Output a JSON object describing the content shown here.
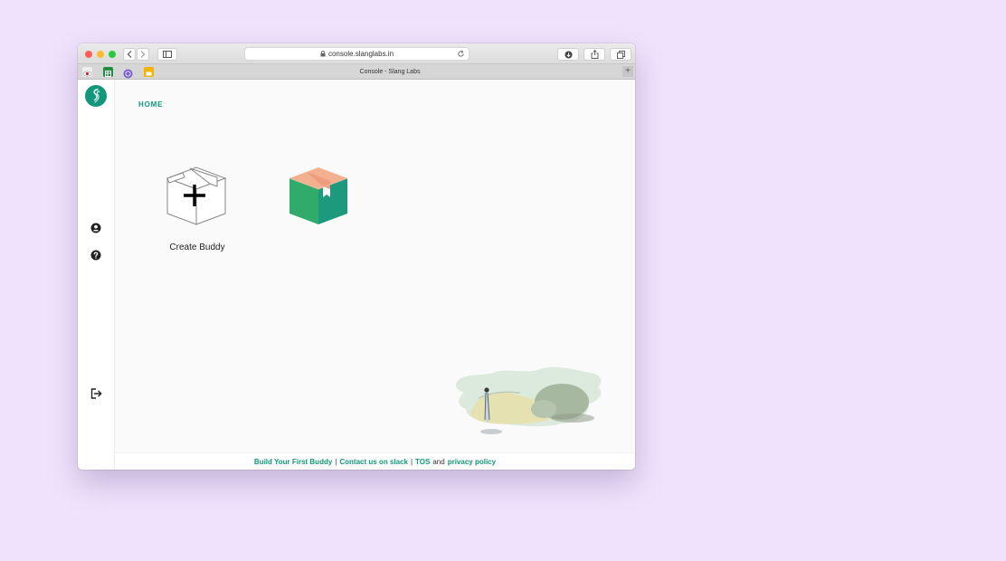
{
  "browser": {
    "url": "console.slanglabs.in",
    "tab_title": "Console - Slang Labs",
    "new_tab_symbol": "+"
  },
  "sidebar": {
    "items": [
      {
        "icon": "account-icon"
      },
      {
        "icon": "help-icon"
      },
      {
        "icon": "logout-icon"
      }
    ]
  },
  "main": {
    "section_title": "HOME",
    "cards": [
      {
        "label": "Create Buddy",
        "icon": "add-box-icon"
      },
      {
        "label": "",
        "icon": "box-icon"
      }
    ]
  },
  "footer": {
    "link_build": "Build Your First Buddy",
    "sep1": "|",
    "link_contact": "Contact us on slack",
    "sep2": "|",
    "link_tos": "TOS",
    "and_text": "and",
    "link_privacy": "privacy policy"
  },
  "colors": {
    "brand": "#11987a",
    "background": "#f0e2fd",
    "box_green": "#2fab68",
    "box_tape": "#f0a88a"
  }
}
